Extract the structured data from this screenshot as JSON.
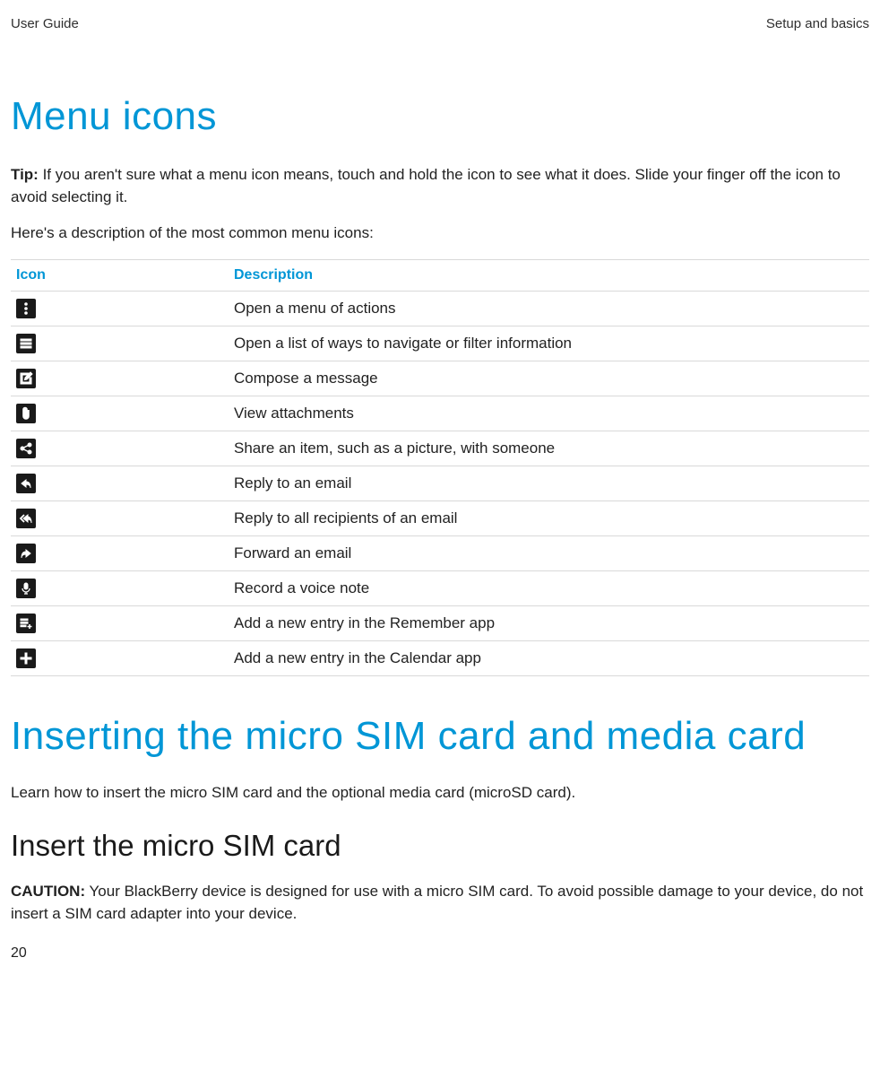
{
  "header": {
    "left": "User Guide",
    "right": "Setup and basics"
  },
  "section1": {
    "title": "Menu icons",
    "tip_label": "Tip:",
    "tip_text": " If you aren't sure what a menu icon means, touch and hold the icon to see what it does. Slide your finger off the icon to avoid selecting it.",
    "intro": "Here's a description of the most common menu icons:",
    "col_icon": "Icon",
    "col_desc": "Description",
    "rows": [
      {
        "icon": "overflow-icon",
        "desc": "Open a menu of actions"
      },
      {
        "icon": "list-icon",
        "desc": "Open a list of ways to navigate or filter information"
      },
      {
        "icon": "compose-icon",
        "desc": "Compose a message"
      },
      {
        "icon": "attachment-icon",
        "desc": "View attachments"
      },
      {
        "icon": "share-icon",
        "desc": "Share an item, such as a picture, with someone"
      },
      {
        "icon": "reply-icon",
        "desc": "Reply to an email"
      },
      {
        "icon": "reply-all-icon",
        "desc": "Reply to all recipients of an email"
      },
      {
        "icon": "forward-icon",
        "desc": "Forward an email"
      },
      {
        "icon": "microphone-icon",
        "desc": "Record a voice note"
      },
      {
        "icon": "add-note-icon",
        "desc": "Add a new entry in the Remember app"
      },
      {
        "icon": "add-plus-icon",
        "desc": "Add a new entry in the Calendar app"
      }
    ]
  },
  "section2": {
    "title": "Inserting the micro SIM card and media card",
    "intro": "Learn how to insert the micro SIM card and the optional media card (microSD card).",
    "subhead": "Insert the micro SIM card",
    "caution_label": "CAUTION:",
    "caution_text": " Your BlackBerry device is designed for use with a micro SIM card. To avoid possible damage to your device, do not insert a SIM card adapter into your device."
  },
  "page_number": "20"
}
